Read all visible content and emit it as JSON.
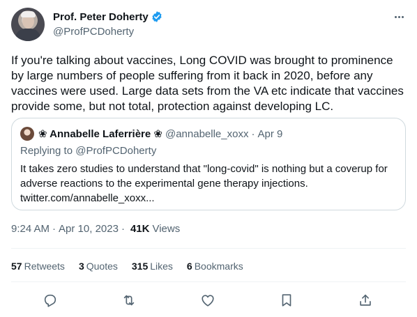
{
  "author": {
    "display_name": "Prof. Peter Doherty",
    "handle": "@ProfPCDoherty",
    "verified": true
  },
  "tweet": {
    "text": "If you're talking about vaccines, Long COVID was brought to prominence by large numbers of people suffering from it back in 2020, before any vaccines were used. Large data sets from the VA etc indicate  that vaccines provide some, but not total, protection against developing LC."
  },
  "quote": {
    "display_name": "❀ Annabelle Laferrière ❀",
    "handle": "@annabelle_xoxx",
    "separator": "·",
    "date": "Apr 9",
    "reply_prefix": "Replying to",
    "reply_to": "@ProfPCDoherty",
    "text": "It takes zero studies to understand that \"long-covid\" is nothing but a coverup for adverse reactions to the experimental gene therapy injections.",
    "link": "twitter.com/annabelle_xoxx..."
  },
  "meta": {
    "time": "9:24 AM",
    "separator": "·",
    "date": "Apr 10, 2023",
    "views_count": "41K",
    "views_label": "Views"
  },
  "stats": {
    "retweets_count": "57",
    "retweets_label": "Retweets",
    "quotes_count": "3",
    "quotes_label": "Quotes",
    "likes_count": "315",
    "likes_label": "Likes",
    "bookmarks_count": "6",
    "bookmarks_label": "Bookmarks"
  },
  "actions": [
    "reply-icon",
    "retweet-icon",
    "like-icon",
    "bookmark-icon",
    "share-icon"
  ],
  "colors": {
    "text": "#0f1419",
    "secondary": "#536471",
    "verified": "#1d9bf0",
    "border": "#cfd9de"
  }
}
